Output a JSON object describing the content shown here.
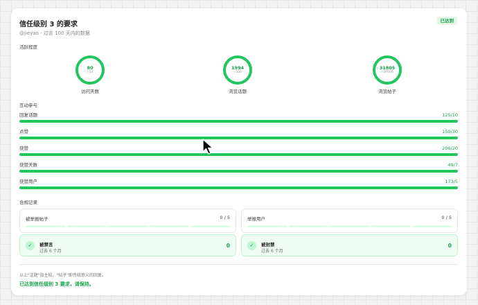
{
  "header": {
    "title": "信任级别 3 的要求",
    "subtitle": "@jieyao - 过去 100 天内的数据",
    "badge": "已达到",
    "accent_color": "#22c55e"
  },
  "activity": {
    "label": "活跃程度",
    "rings": [
      {
        "value": "80",
        "requirement": "/ 50",
        "label": "访问天数"
      },
      {
        "value": "1994",
        "requirement": "/ 500",
        "label": "浏览话题"
      },
      {
        "value": "31805",
        "requirement": "/ 20000",
        "label": "浏览帖子"
      }
    ]
  },
  "interaction": {
    "label": "互动参与",
    "bars": [
      {
        "name": "回复话题",
        "value": "125/10",
        "progress": 1.0
      },
      {
        "name": "点赞",
        "value": "150/30",
        "progress": 1.0
      },
      {
        "name": "获赞",
        "value": "206/20",
        "progress": 1.0
      },
      {
        "name": "获赞天数",
        "value": "49/7",
        "progress": 1.0
      },
      {
        "name": "获赞用户",
        "value": "173/5",
        "progress": 1.0
      }
    ]
  },
  "compliance": {
    "label": "合规记录",
    "reported_posts": {
      "label": "被举报帖子",
      "value": "0 / 5",
      "segments_filled": 0,
      "segments_total": 5
    },
    "reported_users": {
      "label": "举报用户",
      "value": "0 / 5",
      "segments_filled": 0,
      "segments_total": 5
    },
    "silenced": {
      "title": "被禁言",
      "period": "过去 6 个月",
      "count": "0",
      "icon": "check-icon"
    },
    "suspended": {
      "title": "被封禁",
      "period": "过去 6 个月",
      "count": "0",
      "icon": "check-icon"
    }
  },
  "footer": {
    "note": "以上\"话题\"指主帖。\"帖子\"即传统意义的回复。",
    "status": "已达到信任级别 3 要求，请保持。"
  }
}
